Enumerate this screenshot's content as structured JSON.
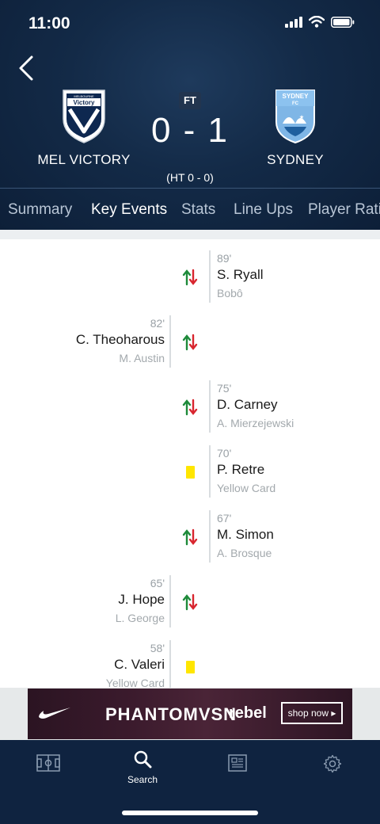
{
  "status_bar": {
    "time": "11:00"
  },
  "match": {
    "status": "FT",
    "score": "0 - 1",
    "halftime": "(HT 0 - 0)",
    "home_team": {
      "name": "MEL VICTORY",
      "crest_text_top": "MELBOURNE",
      "crest_text": "Victory"
    },
    "away_team": {
      "name": "SYDNEY",
      "crest_text": "SYDNEY",
      "crest_sub": "FC"
    }
  },
  "tabs": [
    {
      "label": "Summary",
      "active": false
    },
    {
      "label": "Key Events",
      "active": true
    },
    {
      "label": "Stats",
      "active": false
    },
    {
      "label": "Line Ups",
      "active": false
    },
    {
      "label": "Player Rati",
      "active": false
    }
  ],
  "events": [
    {
      "side": "right",
      "minute": "89'",
      "player": "S. Ryall",
      "detail": "Bobô",
      "type": "substitution"
    },
    {
      "side": "left",
      "minute": "82'",
      "player": "C. Theoharous",
      "detail": "M. Austin",
      "type": "substitution"
    },
    {
      "side": "right",
      "minute": "75'",
      "player": "D. Carney",
      "detail": "A. Mierzejewski",
      "type": "substitution"
    },
    {
      "side": "right",
      "minute": "70'",
      "player": "P. Retre",
      "detail": "Yellow Card",
      "type": "yellow-card"
    },
    {
      "side": "right",
      "minute": "67'",
      "player": "M. Simon",
      "detail": "A. Brosque",
      "type": "substitution"
    },
    {
      "side": "left",
      "minute": "65'",
      "player": "J. Hope",
      "detail": "L. George",
      "type": "substitution"
    },
    {
      "side": "left",
      "minute": "58'",
      "player": "C. Valeri",
      "detail": "Yellow Card",
      "type": "yellow-card"
    }
  ],
  "ad": {
    "brand": "PHANTOMVSN",
    "retailer": "rebel",
    "cta": "shop now ▸"
  },
  "bottom_nav": [
    {
      "label": "",
      "icon": "pitch-icon"
    },
    {
      "label": "Search",
      "icon": "search-icon"
    },
    {
      "label": "",
      "icon": "news-icon"
    },
    {
      "label": "",
      "icon": "gear-icon"
    }
  ],
  "colors": {
    "header_bg": "#132a47",
    "nav_bg": "#0f2340",
    "yellow_card": "#ffe600",
    "sub_in_green": "#1e8a3a",
    "sub_out_red": "#d8262f"
  }
}
